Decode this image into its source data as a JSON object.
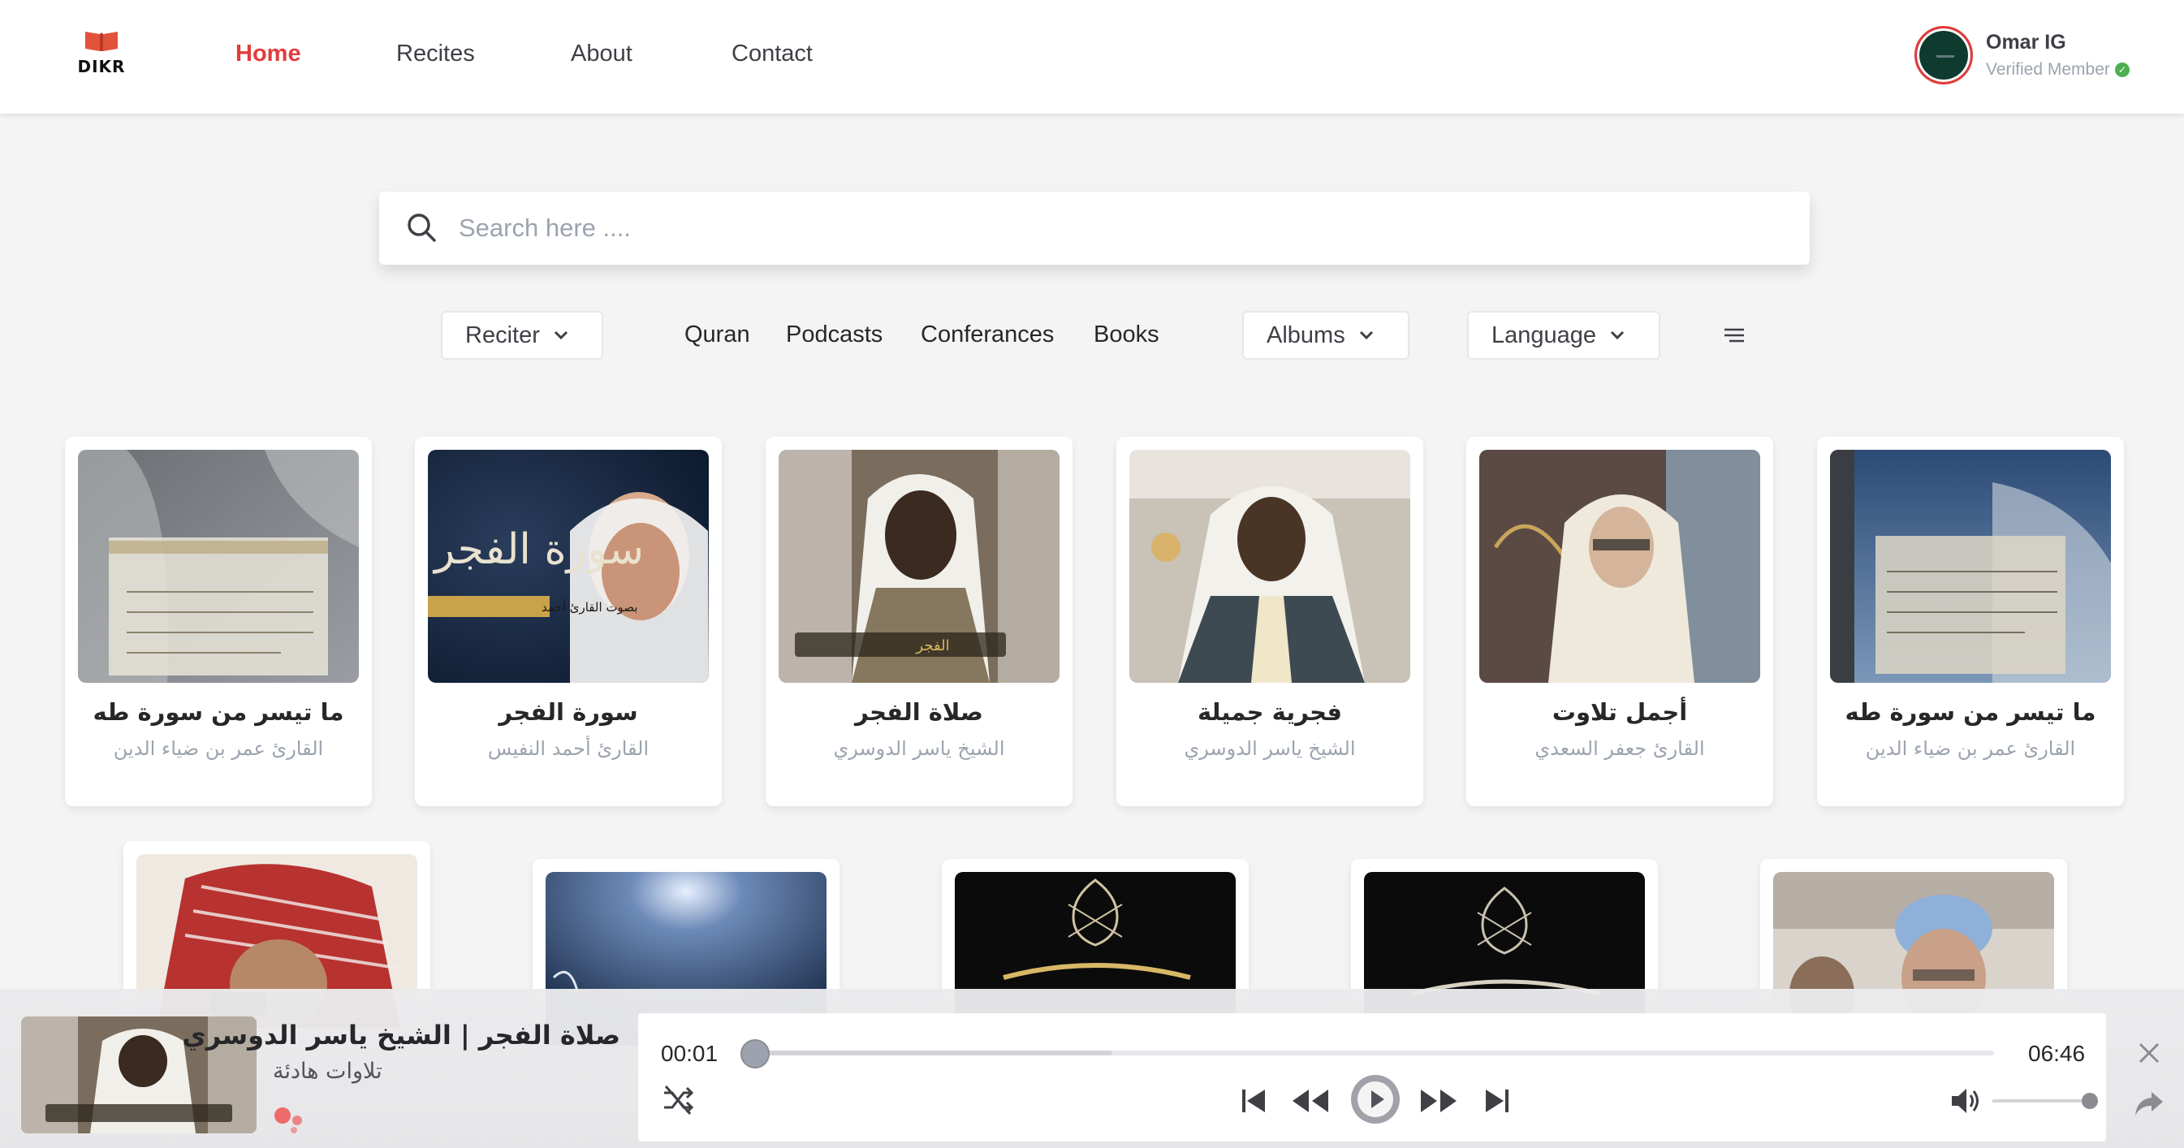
{
  "brand": {
    "name": "DIKR"
  },
  "nav": [
    {
      "label": "Home",
      "active": true
    },
    {
      "label": "Recites",
      "active": false
    },
    {
      "label": "About",
      "active": false
    },
    {
      "label": "Contact",
      "active": false
    }
  ],
  "user": {
    "name": "Omar IG",
    "status": "Verified Member"
  },
  "search": {
    "placeholder": "Search here ....",
    "value": ""
  },
  "filters": {
    "reciter_label": "Reciter",
    "links": [
      "Quran",
      "Podcasts",
      "Conferances",
      "Books"
    ],
    "albums_label": "Albums",
    "language_label": "Language"
  },
  "cards": [
    {
      "title": "ما تيسر من سورة طه",
      "reciter": "القارئ عمر بن ضياء الدين"
    },
    {
      "title": "سورة الفجر",
      "reciter": "القارئ أحمد النفيس",
      "thumb_text": "سورة الفجر",
      "thumb_caption": "بصوت القارئ أحمد"
    },
    {
      "title": "صلاة الفجر",
      "reciter": "الشيخ ياسر الدوسري",
      "thumb_caption": "الفجر"
    },
    {
      "title": "فجرية جميلة",
      "reciter": "الشيخ ياسر الدوسري"
    },
    {
      "title": "أجمل تلاوت",
      "reciter": "القارئ جعفر السعدي"
    },
    {
      "title": "ما تيسر من سورة طه",
      "reciter": "القارئ عمر بن ضياء الدين"
    }
  ],
  "player": {
    "title": "صلاة الفجر | الشيخ ياسر الدوسري",
    "album": "تلاوات هادئة",
    "current_time": "00:01",
    "duration": "06:46",
    "progress_fraction": 0.0025,
    "buffered_fraction": 0.29,
    "volume_fraction": 1.0
  },
  "colors": {
    "accent": "#e23b3b",
    "verified": "#4caf50"
  }
}
